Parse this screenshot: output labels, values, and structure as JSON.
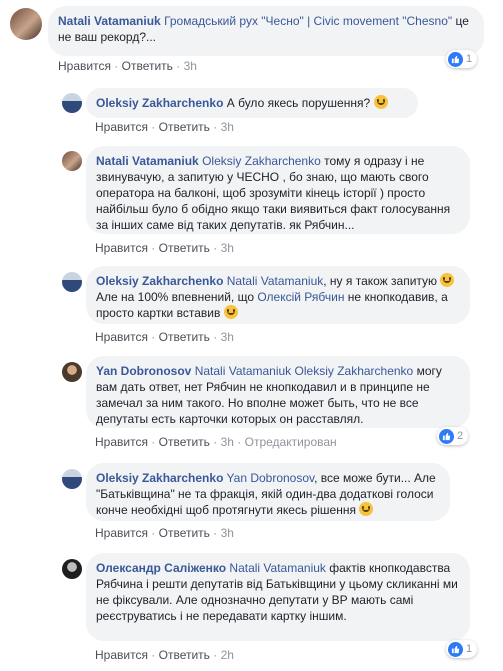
{
  "actions": {
    "like": "Нравится",
    "reply": "Ответить",
    "edited": "Отредактирован",
    "dot": " · "
  },
  "comments": [
    {
      "author": "Natali Vatamaniuk",
      "mention": "Громадський рух \"Чесно\" | Civic movement \"Chesno\"",
      "text": " це не ваш рекорд?...",
      "time": "3h",
      "reactions": "1"
    },
    {
      "author": "Oleksiy Zakharchenko",
      "text": "А було якесь порушення?",
      "time": "3h"
    },
    {
      "author": "Natali Vatamaniuk",
      "mention": "Oleksiy Zakharchenko",
      "text": " тому я одразу і не звинувачую, а запитую у ЧЕСНО , бо знаю, що мають свого оператора на балконі, щоб зрозуміти кінець історії ) просто найбільш було б обідно якщо таки виявиться факт голосування за інших саме від таких депутатів. як Рябчин...",
      "time": "3h"
    },
    {
      "author": "Oleksiy Zakharchenko",
      "mention": "Natali Vatamaniuk",
      "text1": ", ну я також запитую",
      "text2": " Але на 100% впевнений, що ",
      "mention2": "Олексій Рябчин",
      "text3": " не кнопкодавив, а просто картки вставив",
      "time": "3h"
    },
    {
      "author": "Yan Dobronosov",
      "mention": "Natali Vatamaniuk Oleksiy Zakharchenko",
      "text": " могу вам дать ответ, нет Рябчин не кнопкодавил и в принципе не замечал за ним такого. Но вполне может быть, что не все депутаты есть карточки которых он расставлял.",
      "time": "3h",
      "reactions": "2"
    },
    {
      "author": "Oleksiy Zakharchenko",
      "mention": "Yan Dobronosov",
      "text": ", все може бути... Але \"Батьківщина\" не та фракція, якій один-два додаткові голоси конче необхідні щоб протягнути якесь рішення",
      "time": "3h"
    },
    {
      "author": "Олександр Саліженко",
      "mention": "Natali Vatamaniuk",
      "text": " фактів кнопкодавства Рябчина і решти депутатів від Батьківщини у цьому скликанні ми не фіксували. Але однозначно депутати у ВР мають самі реєструватись і не передавати картку іншим.",
      "time": "2h",
      "reactions": "1"
    }
  ]
}
